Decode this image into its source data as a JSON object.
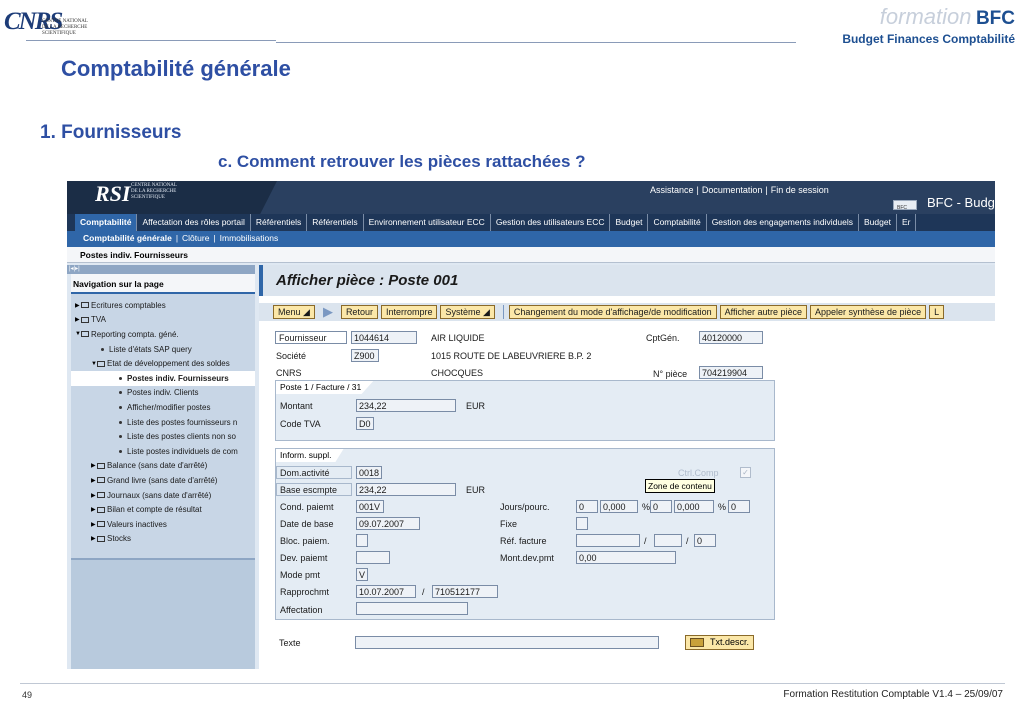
{
  "slide": {
    "logo_mark": "CNRS",
    "logo_text_1": "CENTRE NATIONAL",
    "logo_text_2": "DE LA RECHERCHE",
    "logo_text_3": "SCIENTIFIQUE",
    "brand_formation": "formation",
    "brand_bfc": "BFC",
    "brand_sub": "Budget Finances Comptabilité",
    "title": "Comptabilité générale",
    "section": "1. Fournisseurs",
    "subsection": "c. Comment retrouver les pièces rattachées ?",
    "page_number": "49",
    "footer": "Formation Restitution Comptable V1.4 – 25/09/07"
  },
  "sap": {
    "logo": "RSI",
    "logo_text_1": "CENTRE NATIONAL",
    "logo_text_2": "DE LA RECHERCHE",
    "logo_text_3": "SCIENTIFIQUE",
    "links": [
      "Assistance",
      "Documentation",
      "Fin de session"
    ],
    "app_icon": "BFC",
    "app_title": "BFC - Budg",
    "tabs": [
      "Comptabilité",
      "Affectation des rôles portail",
      "Référentiels",
      "Référentiels",
      "Environnement utilisateur ECC",
      "Gestion des utilisateurs ECC",
      "Budget",
      "Comptabilité",
      "Gestion des engagements individuels",
      "Budget",
      "Er"
    ],
    "subtabs": [
      "Comptabilité générale",
      "Clôture",
      "Immobilisations"
    ],
    "breadcrumb": "Postes indiv. Fournisseurs",
    "nav_strip": "|◂|▸|",
    "nav_title": "Navigation sur la page",
    "nav_items": [
      "Ecritures comptables",
      "TVA",
      "Reporting compta. géné.",
      "Liste d'états SAP query",
      "Etat de développement des soldes",
      "Postes indiv. Fournisseurs",
      "Postes indiv. Clients",
      "Afficher/modifier postes",
      "Liste des postes fournisseurs n",
      "Liste des postes clients non so",
      "Liste postes individuels de com",
      "Balance (sans date d'arrêté)",
      "Grand livre (sans date d'arrêté)",
      "Journaux (sans date d'arrêté)",
      "Bilan et compte de résultat",
      "Valeurs inactives",
      "Stocks"
    ],
    "content_title": "Afficher pièce : Poste 001",
    "toolbar": {
      "menu": "Menu",
      "back": "Retour",
      "cancel": "Interrompre",
      "system": "Système",
      "change_mode": "Changement du mode d'affichage/de modification",
      "other_doc": "Afficher autre pièce",
      "synthesis": "Appeler synthèse de pièce",
      "more": "L"
    },
    "header_fields": {
      "fournisseur_label": "Fournisseur",
      "fournisseur_value": "1044614",
      "fournisseur_name": "AIR LIQUIDE",
      "cptgen_label": "CptGén.",
      "cptgen_value": "40120000",
      "societe_label": "Société",
      "societe_value": "Z900",
      "address": "1015 ROUTE DE LABEUVRIERE B.P. 2",
      "company_name": "CNRS",
      "city": "CHOCQUES",
      "piece_label": "N° pièce",
      "piece_value": "704219904"
    },
    "poste_group": {
      "title": "Poste 1 / Facture / 31",
      "montant_label": "Montant",
      "montant_value": "234,22",
      "montant_currency": "EUR",
      "tva_label": "Code TVA",
      "tva_value": "D0"
    },
    "inform_group": {
      "title": "Inform. suppl.",
      "dom_activite_label": "Dom.activité",
      "dom_activite_value": "0018",
      "ctrl_comp_label": "Ctrl.Comp",
      "tooltip": "Zone de contenu",
      "base_escompte_label": "Base escmpte",
      "base_escompte_value": "234,22",
      "base_escompte_currency": "EUR",
      "cond_paiement_label": "Cond. paiemt",
      "cond_paiement_value": "001V",
      "jours_label": "Jours/pourc.",
      "jours_1": "0",
      "pourc_1": "0,000",
      "pct_1": "%",
      "jours_2": "0",
      "pourc_2": "0,000",
      "pct_2": "%",
      "jours_3": "0",
      "date_base_label": "Date de base",
      "date_base_value": "09.07.2007",
      "fixe_label": "Fixe",
      "bloc_label": "Bloc. paiem.",
      "ref_facture_label": "Réf. facture",
      "ref_sep_1": "/",
      "ref_sep_2": "/",
      "ref_value_3": "0",
      "dev_paiement_label": "Dev. paiemt",
      "mont_dev_label": "Mont.dev.pmt",
      "mont_dev_value": "0,00",
      "mode_pmt_label": "Mode pmt",
      "mode_pmt_value": "V",
      "rapprochement_label": "Rapprochmt",
      "rapprochement_date": "10.07.2007",
      "rapprochement_sep": "/",
      "rapprochement_value": "710512177",
      "affectation_label": "Affectation",
      "texte_label": "Texte",
      "txt_descr": "Txt.descr."
    }
  }
}
